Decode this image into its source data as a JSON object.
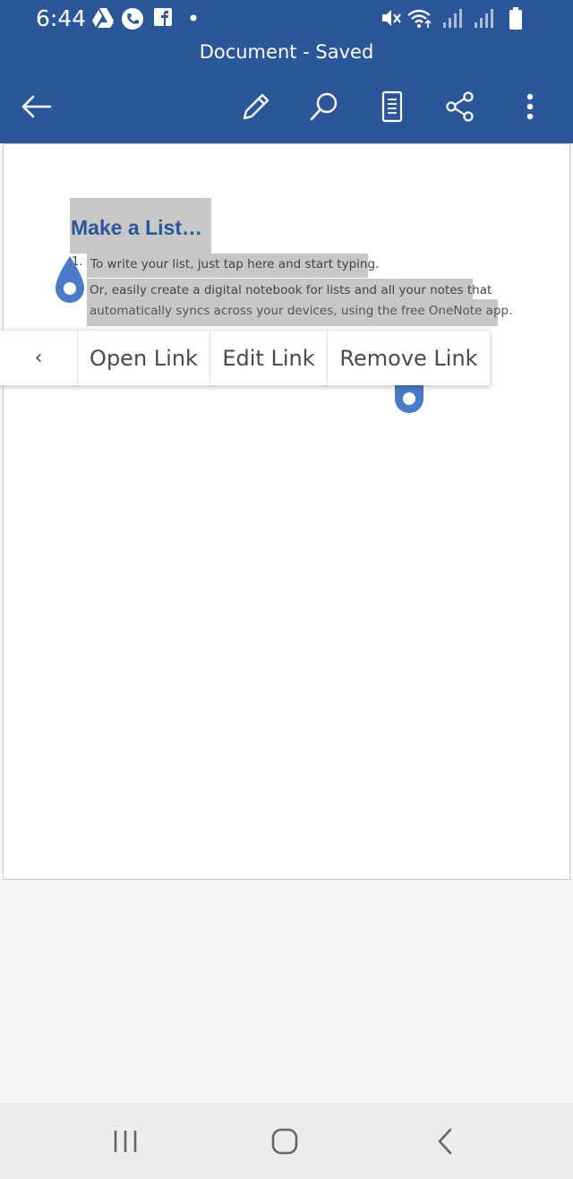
{
  "status_bar": {
    "time": "6:44",
    "left_icons": [
      "google-drive-icon",
      "phone-call-icon",
      "facebook-icon",
      "notification-dot-icon"
    ],
    "right_icons": [
      "mute-icon",
      "wifi-icon",
      "signal-icon",
      "signal-icon",
      "battery-icon"
    ]
  },
  "header": {
    "title": "Document - Saved",
    "toolbar": [
      "back-arrow-icon",
      "edit-pencil-icon",
      "search-icon",
      "mobile-view-icon",
      "share-icon",
      "more-vertical-icon"
    ]
  },
  "document": {
    "heading": "Make a List…",
    "bullet_number": "1.",
    "line1": "To write your list, just tap here and start typing.",
    "line2": "Or, easily create a digital notebook for lists and all your notes that",
    "line3": "automatically syncs across your devices, using the free OneNote app."
  },
  "context_menu": {
    "back_label": "‹",
    "items": [
      "Open Link",
      "Edit Link",
      "Remove Link"
    ]
  },
  "colors": {
    "brand": "#2b579a",
    "handle": "#4a7bc8",
    "selection": "#c7c7c7"
  },
  "nav_bar": [
    "recent-apps-icon",
    "home-icon",
    "back-icon"
  ]
}
